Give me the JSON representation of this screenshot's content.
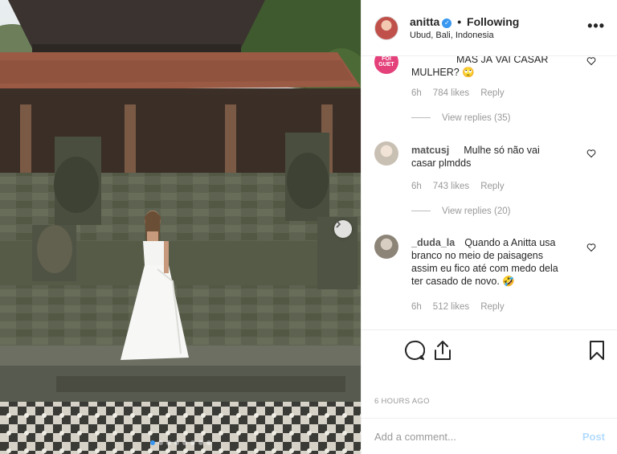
{
  "post": {
    "username": "anitta",
    "follow_status": "Following",
    "separator": "•",
    "verified_glyph": "✓",
    "location": "Ubud, Bali, Indonesia",
    "more_glyph": "•••",
    "timestamp": "6 HOURS AGO",
    "add_comment_placeholder": "Add a comment...",
    "post_label": "Post",
    "carousel": {
      "dots": 8,
      "active_index": 0
    }
  },
  "comments": [
    {
      "username": "",
      "avatar_text": "FOI GUET",
      "text_lines": [
        "MAS JÁ VAI CASAR",
        "MULHER? 🙄"
      ],
      "age": "6h",
      "likes": "784 likes",
      "reply": "Reply",
      "view_replies": "View replies (35)"
    },
    {
      "username": "matcusj",
      "text_lines": [
        "Mulhe só não vai",
        "casar plmdds"
      ],
      "age": "6h",
      "likes": "743 likes",
      "reply": "Reply",
      "view_replies": "View replies (20)"
    },
    {
      "username": "_duda_la",
      "text_lines": [
        "Quando a Anitta usa",
        "branco no meio de paisagens",
        "assim eu fico até com medo dela",
        "ter casado de novo. 🤣"
      ],
      "age": "6h",
      "likes": "512 likes",
      "reply": "Reply",
      "view_replies": ""
    }
  ],
  "icons": [
    "comment-icon",
    "share-icon",
    "bookmark-icon",
    "heart-icon",
    "chevron-right-icon",
    "verified-icon",
    "more-icon"
  ],
  "colors": {
    "accent": "#3897f0",
    "post_disabled": "#b3dbff",
    "muted": "#999999"
  }
}
